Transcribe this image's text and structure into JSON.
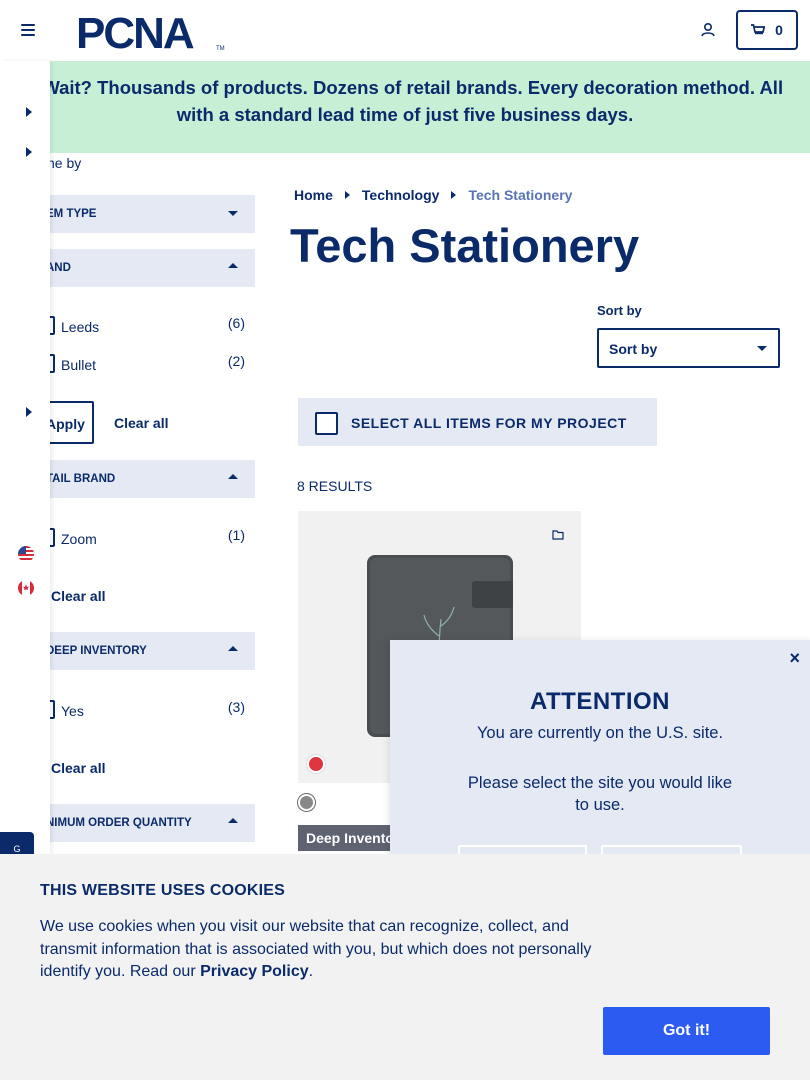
{
  "header": {
    "logo_text": "PCNA",
    "logo_tm": "TM",
    "cart_count": "0",
    "icons": [
      "menu-icon",
      "user-icon",
      "cart-icon"
    ]
  },
  "banner": {
    "line1": "y Wait? Thousands of products. Dozens of retail brands. Every decoration method. All",
    "line2": "with a standard lead time of just five business days."
  },
  "filters": {
    "refine_label": "fine by",
    "item_type": {
      "title": "em type"
    },
    "brand": {
      "title": "and",
      "options": [
        {
          "label": "Leeds",
          "count": "(6)"
        },
        {
          "label": "Bullet",
          "count": "(2)"
        }
      ],
      "apply_label": "Apply",
      "clear_label": "Clear all"
    },
    "retail_brand": {
      "title": "tail brand",
      "options": [
        {
          "label": "Zoom",
          "count": "(1)"
        }
      ],
      "clear_label": "Clear all"
    },
    "deep_inventory": {
      "title": "deep inventory",
      "options": [
        {
          "label": "Yes",
          "count": "(3)"
        }
      ],
      "clear_label": "Clear all"
    },
    "min_order": {
      "title": "nimum order quantity"
    }
  },
  "breadcrumb": {
    "home": "Home",
    "category": "Technology",
    "current": "Tech Stationery"
  },
  "page_title": "Tech Stationery",
  "sort": {
    "label": "Sort by",
    "selected": "Sort by"
  },
  "select_all_label": "SELECT ALL ITEMS FOR MY PROJECT",
  "results_label": "8 RESULTS",
  "product": {
    "badge": "Deep Inventory",
    "colors": {
      "swatch1": "#e03440",
      "swatch2": "#888888"
    }
  },
  "modal": {
    "title": "ATTENTION",
    "line1": "You are currently on the U.S. site.",
    "line2": "Please select the site you would like to use.",
    "close": "×"
  },
  "chat_tab": "G",
  "cookie": {
    "title": "THIS WEBSITE USES COOKIES",
    "body": "We use cookies when you visit our website that can recognize, collect, and transmit information that is associated with you, but which does not personally identify you. Read our ",
    "policy_link": "Privacy Policy",
    "period": ".",
    "button": "Got it!"
  },
  "colors": {
    "navy": "#0b2a6a",
    "banner_green": "#c6efd6",
    "filter_bg": "#e4e9f4",
    "button_blue": "#2c5bf2"
  }
}
